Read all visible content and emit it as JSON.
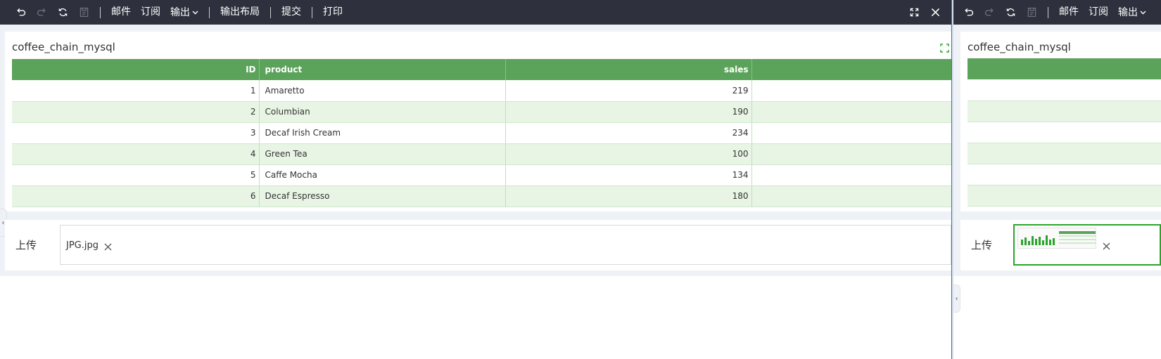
{
  "toolbar": {
    "menu": [
      "邮件",
      "订阅",
      "输出",
      "输出布局",
      "提交",
      "打印"
    ],
    "icons": [
      "undo-icon",
      "redo-icon",
      "refresh-icon",
      "save-icon"
    ],
    "right_icons": [
      "fullscreen-icon",
      "close-icon"
    ]
  },
  "report": {
    "title": "coffee_chain_mysql",
    "columns": [
      "ID",
      "product",
      "sales"
    ],
    "rows": [
      [
        "1",
        "Amaretto",
        "219"
      ],
      [
        "2",
        "Columbian",
        "190"
      ],
      [
        "3",
        "Decaf Irish Cream",
        "234"
      ],
      [
        "4",
        "Green Tea",
        "100"
      ],
      [
        "5",
        "Caffe Mocha",
        "134"
      ],
      [
        "6",
        "Decaf Espresso",
        "180"
      ]
    ]
  },
  "upload": {
    "label": "上传",
    "file_name": "JPG.jpg"
  },
  "right_pane": {
    "menu": [
      "邮件",
      "订阅",
      "输出"
    ],
    "title": "coffee_chain_mysql",
    "upload_label": "上传"
  },
  "colors": {
    "toolbar_bg": "#2e313d",
    "header_green": "#5ba35a",
    "row_alt": "#e8f5e5",
    "accent_green": "#2aa52a"
  }
}
